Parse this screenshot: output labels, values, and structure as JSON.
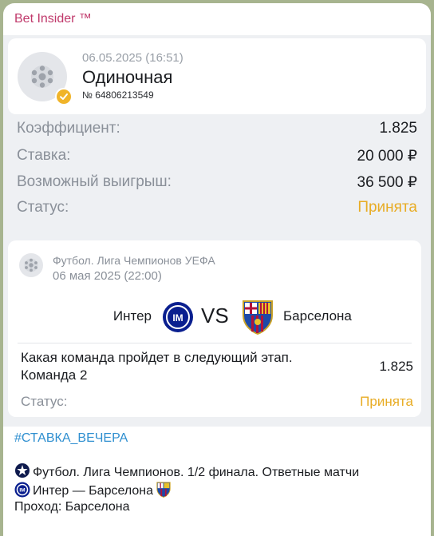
{
  "channel": {
    "name": "Bet Insider ™"
  },
  "bet": {
    "date": "06.05.2025 (16:51)",
    "type": "Одиночная",
    "number": "№ 64806213549"
  },
  "summary": [
    {
      "label": "Коэффициент:",
      "value": "1.825"
    },
    {
      "label": "Ставка:",
      "value": "20 000 ₽"
    },
    {
      "label": "Возможный выигрыш:",
      "value": "36 500 ₽"
    },
    {
      "label": "Статус:",
      "value": "Принята"
    }
  ],
  "event": {
    "league": "Футбол. Лига Чемпионов УЕФА",
    "date": "06 мая 2025 (22:00)",
    "home": "Интер",
    "vs": "VS",
    "away": "Барселона",
    "market": "Какая команда пройдет в следующий этап. Команда 2",
    "odds": "1.825",
    "status_label": "Статус:",
    "status_value": "Принята"
  },
  "caption": {
    "hashtag": "#СТАВКА_ВЕЧЕРА",
    "line1": "Футбол. Лига Чемпионов. 1/2 финала. Ответные матчи",
    "line2": "Интер — Барселона",
    "line3": "Проход: Барселона"
  },
  "colors": {
    "accent": "#e8ac24",
    "channel": "#c0396b",
    "link": "#2f8fd0",
    "inter": "#0a1f8f",
    "barca_blue": "#1d4aa8",
    "barca_red": "#b3123a"
  },
  "icons": [
    "soccer-ball-icon",
    "check-badge-icon",
    "inter-crest-icon",
    "barcelona-crest-icon"
  ]
}
